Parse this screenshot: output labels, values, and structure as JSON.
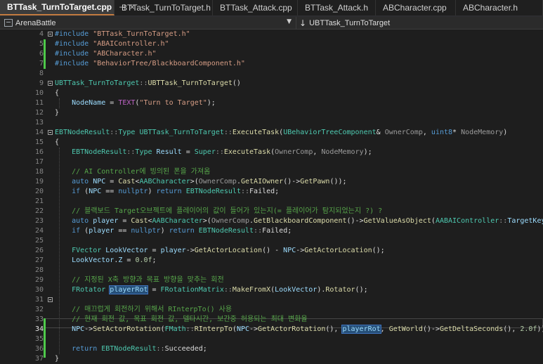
{
  "tabs": [
    {
      "label": "BTTask_TurnToTarget.cpp",
      "active": true
    },
    {
      "label": "BTTask_TurnToTarget.h"
    },
    {
      "label": "BTTask_Attack.cpp"
    },
    {
      "label": "BTTask_Attack.h"
    },
    {
      "label": "ABCharacter.cpp"
    },
    {
      "label": "ABCharacter.h"
    }
  ],
  "tab_pin_icon": "pin-icon",
  "tab_close_icon": "close-icon",
  "navbar": {
    "project": "ArenaBattle",
    "scope": "UBTTask_TurnToTarget"
  },
  "code": {
    "current_line": 34,
    "lines": [
      {
        "n": "4"
      },
      {
        "n": "5"
      },
      {
        "n": "6"
      },
      {
        "n": "7"
      },
      {
        "n": "8"
      },
      {
        "n": "9"
      },
      {
        "n": "10"
      },
      {
        "n": "11"
      },
      {
        "n": "12"
      },
      {
        "n": "13"
      },
      {
        "n": "14"
      },
      {
        "n": "15"
      },
      {
        "n": "16"
      },
      {
        "n": "17"
      },
      {
        "n": "18"
      },
      {
        "n": "19"
      },
      {
        "n": "20"
      },
      {
        "n": "21"
      },
      {
        "n": "22"
      },
      {
        "n": "23"
      },
      {
        "n": "24"
      },
      {
        "n": "25"
      },
      {
        "n": "26"
      },
      {
        "n": "27"
      },
      {
        "n": "28"
      },
      {
        "n": "29"
      },
      {
        "n": "30"
      },
      {
        "n": "31"
      },
      {
        "n": "32"
      },
      {
        "n": "33"
      },
      {
        "n": "34"
      },
      {
        "n": "35"
      },
      {
        "n": "36"
      },
      {
        "n": "37"
      }
    ],
    "tokens": {
      "inc": "#include",
      "h1": "\"BTTask_TurnToTarget.h\"",
      "h2": "\"ABAIController.h\"",
      "h3": "\"ABCharacter.h\"",
      "h4": "\"BehaviorTree/BlackboardComponent.h\"",
      "ctor": "UBTTask_TurnToTarget",
      "sep": "::",
      "ctor2": "UBTTask_TurnToTarget",
      "paren": "()",
      "brace_open": "{",
      "brace_close": "}",
      "nodename": "NodeName",
      "eq": " = ",
      "text_macro": "TEXT",
      "text_str": "\"Turn to Target\"",
      "end": ");",
      "ebt": "EBTNodeResult",
      "type": "Type",
      "cls": "UBTTask_TurnToTarget",
      "exec": "ExecuteTask",
      "ubtc": "UBehaviorTreeComponent",
      "ownercomp": "OwnerComp",
      "uint8": "uint8",
      "nodemem": "NodeMemory",
      "result": "Result",
      "super": "Super",
      "cm1": "// AI Controller에 빙의된 폰을 가져옴",
      "auto": "auto",
      "npc": "NPC",
      "cast": "Cast",
      "aab": "AABCharacter",
      "getaiowner": "GetAIOwner",
      "getpawn": "GetPawn",
      "if": "if",
      "nullptr": "nullptr",
      "return": "return",
      "failed": "Failed",
      "cm2": "// 블랙보드 Target오브젝트에 플레이어의 값이 들어가 있는지(= 플레이어가 탐지되었는지 ?) ?",
      "player": "player",
      "getbb": "GetBlackboardComponent",
      "getvalue": "GetValueAsObject",
      "aabai": "AABAIController",
      "targetkey": "TargetKey",
      "fvector": "FVector",
      "lookvector": "LookVector",
      "getactorloc": "GetActorLocation",
      "z": "Z",
      "zero": "0.0f",
      "cm3": "// 지정된 X축 방향과 목표 방향을 맞추는 회전",
      "frotator": "FRotator",
      "playerrot": "playerRot",
      "frotmatrix": "FRotationMatrix",
      "makefromx": "MakeFromX",
      "rotator": "Rotator",
      "cm4": "// 매끄럽게 회전하기 위해서 RInterpTo() 사용",
      "cm5": "// 현재 회전 값, 목표 회전 값, 델타시간, 보간중 허용되는 최대 변화율",
      "setactorrot": "SetActorRotation",
      "fmath": "FMath",
      "rinterp": "RInterpTo",
      "getactorrot": "GetActorRotation",
      "getworld": "GetWorld",
      "getdelta": "GetDeltaSeconds",
      "twof": "2.0f",
      "succeeded": "Succeeded"
    }
  },
  "colors": {
    "keyword": "#569cd6",
    "type": "#4ec9b0",
    "function": "#dcdcaa",
    "string": "#d69d85",
    "comment": "#57a64a",
    "change_bar": "#4ec94a",
    "active_tab_underline": "#c27b40"
  }
}
